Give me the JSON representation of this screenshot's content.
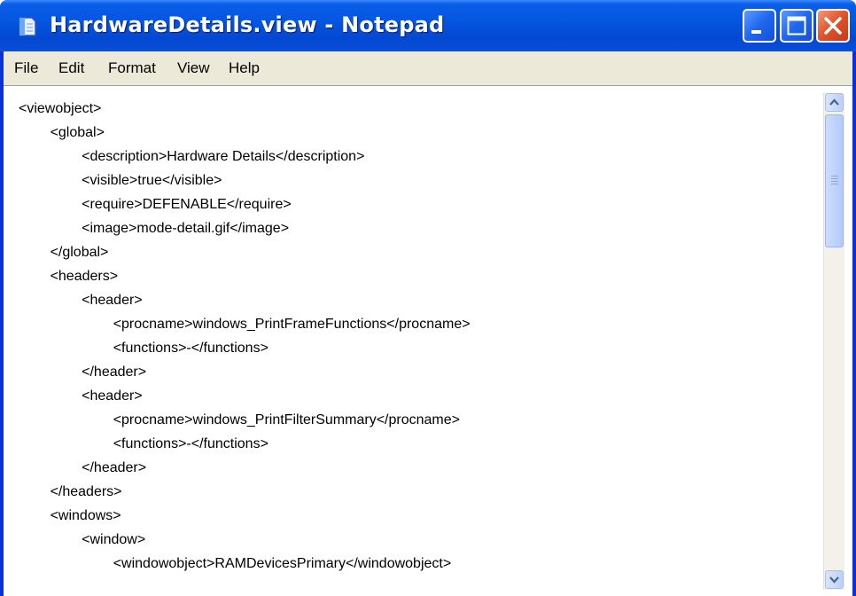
{
  "window": {
    "title": "HardwareDetails.view - Notepad",
    "app_icon": "notepad-icon",
    "controls": [
      "minimize-icon",
      "maximize-icon",
      "close-icon"
    ]
  },
  "menu": {
    "items": [
      "File",
      "Edit",
      "Format",
      "View",
      "Help"
    ]
  },
  "editor": {
    "lines": [
      "<viewobject>",
      "\t<global>",
      "\t\t<description>Hardware Details</description>",
      "\t\t<visible>true</visible>",
      "\t\t<require>DEFENABLE</require>",
      "\t\t<image>mode-detail.gif</image>",
      "\t</global>",
      "\t<headers>",
      "\t\t<header>",
      "\t\t\t<procname>windows_PrintFrameFunctions</procname>",
      "\t\t\t<functions>-</functions>",
      "\t\t</header>",
      "\t\t<header>",
      "\t\t\t<procname>windows_PrintFilterSummary</procname>",
      "\t\t\t<functions>-</functions>",
      "\t\t</header>",
      "\t</headers>",
      "\t<windows>",
      "\t\t<window>",
      "\t\t\t<windowobject>RAMDevicesPrimary</windowobject>"
    ]
  },
  "scrollbar": {
    "up_icon": "chevron-up-icon",
    "down_icon": "chevron-down-icon"
  }
}
